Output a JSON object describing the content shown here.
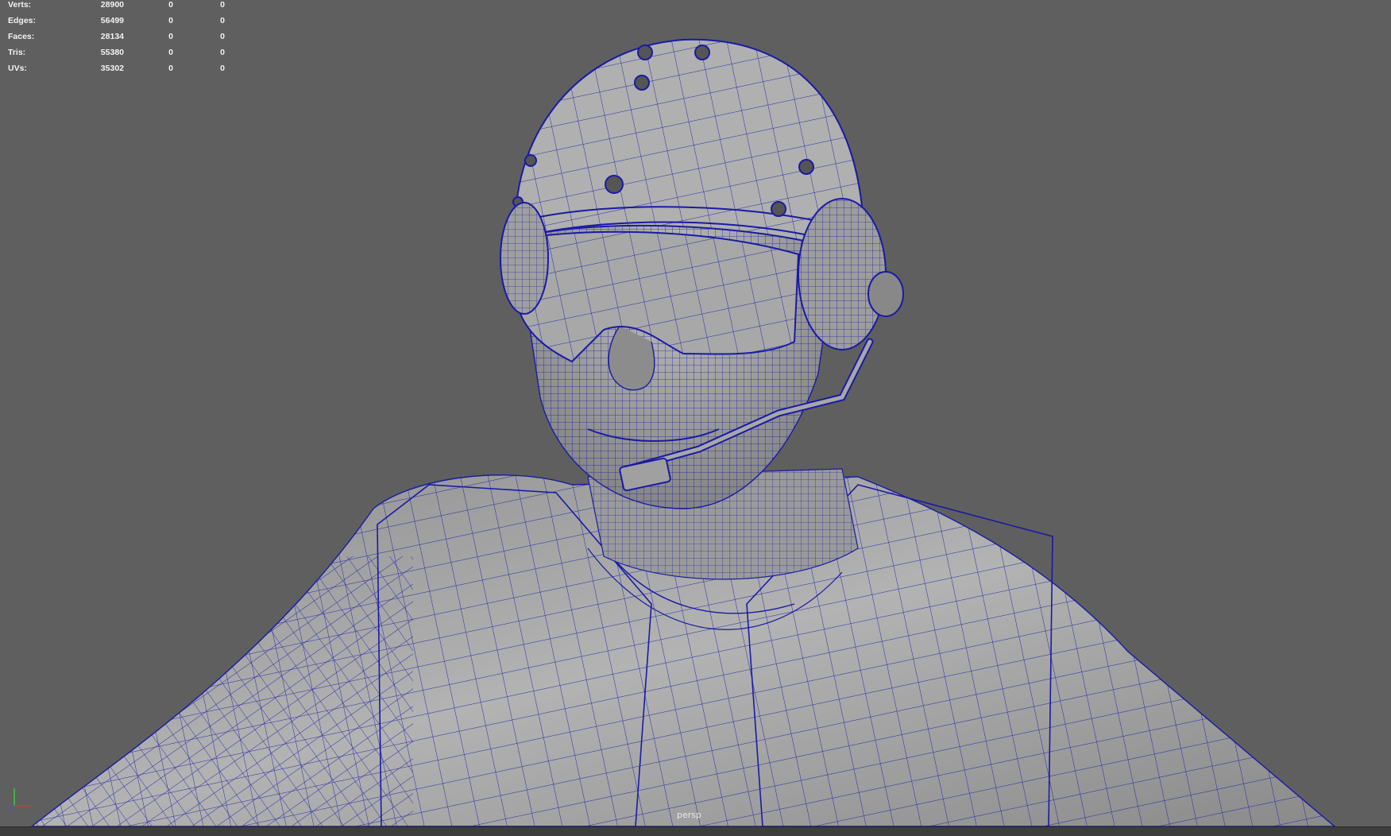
{
  "viewport": {
    "camera_label": "persp",
    "background_color": "#5f5f5f",
    "wire_color": "#1a1aa6"
  },
  "hud": {
    "rows": [
      {
        "label": "Verts:",
        "v1": "28900",
        "v2": "0",
        "v3": "0"
      },
      {
        "label": "Edges:",
        "v1": "56499",
        "v2": "0",
        "v3": "0"
      },
      {
        "label": "Faces:",
        "v1": "28134",
        "v2": "0",
        "v3": "0"
      },
      {
        "label": "Tris:",
        "v1": "55380",
        "v2": "0",
        "v3": "0"
      },
      {
        "label": "UVs:",
        "v1": "35302",
        "v2": "0",
        "v3": "0"
      }
    ]
  },
  "axis_gizmo": {
    "icon": "view-axis-icon",
    "x_color": "#d23a3a",
    "y_color": "#3ac43a",
    "z_color": "#3a5ad2"
  }
}
